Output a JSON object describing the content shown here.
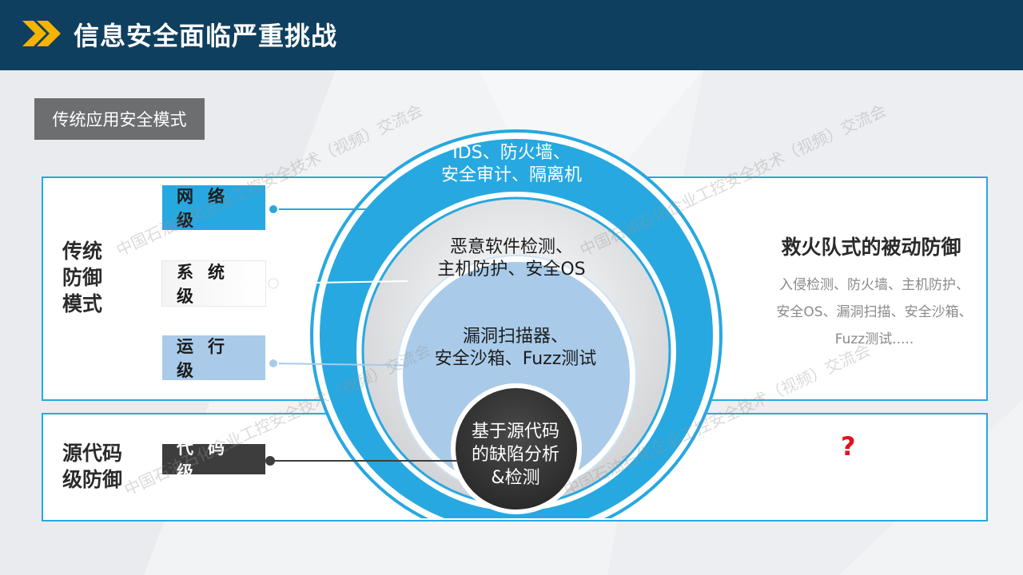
{
  "header": {
    "title": "信息安全面临严重挑战",
    "bar_color": "#0f3f5e",
    "chevron_color": "#f5b400",
    "chevron_icon": "double-chevron-right-icon"
  },
  "subtitle": "传统应用安全模式",
  "left_labels": {
    "traditional": "传统\n防御\n模式",
    "source_code": "源代码\n级防御"
  },
  "levels": {
    "network": "网络级",
    "system": "系统级",
    "runtime": "运行级",
    "code": "代码级"
  },
  "rings": {
    "ring1": "IDS、防火墙、\n安全审计、隔离机",
    "ring2": "恶意软件检测、\n主机防护、安全OS",
    "ring3": "漏洞扫描器、\n安全沙箱、Fuzz测试",
    "core": "基于源代码\n的缺陷分析\n&检测"
  },
  "right": {
    "title": "救火队式的被动防御",
    "desc": "入侵检测、防火墙、主机防护、安全OS、漏洞扫描、安全沙箱、Fuzz测试....."
  },
  "bottom_right": {
    "question": "?"
  },
  "watermark": "中国石油石化企业工控安全技术（视频）交流会",
  "colors": {
    "accent": "#27a8e0",
    "light_blue": "#a9cbe9",
    "dark_core": "#3d3d3d",
    "question": "#e0141e"
  }
}
